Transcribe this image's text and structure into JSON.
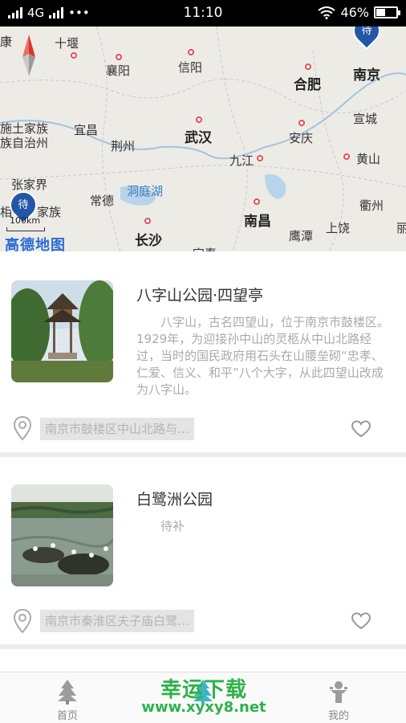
{
  "status_bar": {
    "network": "4G",
    "dots": "•••",
    "time": "11:10",
    "battery": "46%",
    "battery_level": 0.46
  },
  "map": {
    "labels": {
      "kang": "康",
      "shiyan": "十堰",
      "xiangyang": "襄阳",
      "xinyang": "信阳",
      "hefei": "合肥",
      "nanjing": "南京",
      "enshi1": "施土家族",
      "enshi2": "族自治州",
      "yichang": "宜昌",
      "jingzhou": "荆州",
      "wuhan": "武汉",
      "anqing": "安庆",
      "xuancheng": "宣城",
      "jiujiang": "九江",
      "huangshan": "黄山",
      "zhangjiajie": "张家界",
      "xiangxi1": "相",
      "xiangxi2": "家族",
      "changde": "常德",
      "dongtinghu": "洞庭湖",
      "quzhou": "衢州",
      "li": "丽",
      "nanchang": "南昌",
      "changsha": "长沙",
      "yingtan": "鹰潭",
      "shangrao": "上饶",
      "yichun": "宜春"
    },
    "pin_text": "待",
    "scale": "100km",
    "logo": "高德地图"
  },
  "places": [
    {
      "title": "八字山公园·四望亭",
      "description": "八字山，古名四望山，位于南京市鼓楼区。1929年，为迎接孙中山的灵柩从中山北路经过，当时的国民政府用石头在山腰垒砌“忠孝、仁爱、信义、和平”八个大字，从此四望山改成为八字山。",
      "address": "南京市鼓楼区中山北路与…"
    },
    {
      "title": "白鹭洲公园",
      "description": "待补",
      "address": "南京市秦淮区夫子庙白鹭…"
    }
  ],
  "bottom_nav": {
    "home": "首页",
    "mine": "我的"
  },
  "watermark": {
    "line1": "幸运下载",
    "line2": "www.xyxy8.net"
  },
  "colors": {
    "accent": "#3fb4c4",
    "pin": "#2456a6",
    "watermark": "#2eb24a"
  }
}
